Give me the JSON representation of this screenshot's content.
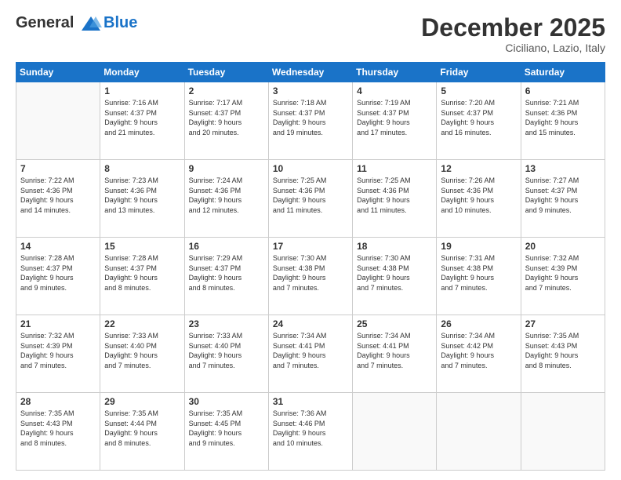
{
  "logo": {
    "line1": "General",
    "line2": "Blue"
  },
  "header": {
    "month_year": "December 2025",
    "location": "Ciciliano, Lazio, Italy"
  },
  "days_of_week": [
    "Sunday",
    "Monday",
    "Tuesday",
    "Wednesday",
    "Thursday",
    "Friday",
    "Saturday"
  ],
  "weeks": [
    [
      {
        "day": "",
        "info": ""
      },
      {
        "day": "1",
        "info": "Sunrise: 7:16 AM\nSunset: 4:37 PM\nDaylight: 9 hours\nand 21 minutes."
      },
      {
        "day": "2",
        "info": "Sunrise: 7:17 AM\nSunset: 4:37 PM\nDaylight: 9 hours\nand 20 minutes."
      },
      {
        "day": "3",
        "info": "Sunrise: 7:18 AM\nSunset: 4:37 PM\nDaylight: 9 hours\nand 19 minutes."
      },
      {
        "day": "4",
        "info": "Sunrise: 7:19 AM\nSunset: 4:37 PM\nDaylight: 9 hours\nand 17 minutes."
      },
      {
        "day": "5",
        "info": "Sunrise: 7:20 AM\nSunset: 4:37 PM\nDaylight: 9 hours\nand 16 minutes."
      },
      {
        "day": "6",
        "info": "Sunrise: 7:21 AM\nSunset: 4:36 PM\nDaylight: 9 hours\nand 15 minutes."
      }
    ],
    [
      {
        "day": "7",
        "info": "Sunrise: 7:22 AM\nSunset: 4:36 PM\nDaylight: 9 hours\nand 14 minutes."
      },
      {
        "day": "8",
        "info": "Sunrise: 7:23 AM\nSunset: 4:36 PM\nDaylight: 9 hours\nand 13 minutes."
      },
      {
        "day": "9",
        "info": "Sunrise: 7:24 AM\nSunset: 4:36 PM\nDaylight: 9 hours\nand 12 minutes."
      },
      {
        "day": "10",
        "info": "Sunrise: 7:25 AM\nSunset: 4:36 PM\nDaylight: 9 hours\nand 11 minutes."
      },
      {
        "day": "11",
        "info": "Sunrise: 7:25 AM\nSunset: 4:36 PM\nDaylight: 9 hours\nand 11 minutes."
      },
      {
        "day": "12",
        "info": "Sunrise: 7:26 AM\nSunset: 4:36 PM\nDaylight: 9 hours\nand 10 minutes."
      },
      {
        "day": "13",
        "info": "Sunrise: 7:27 AM\nSunset: 4:37 PM\nDaylight: 9 hours\nand 9 minutes."
      }
    ],
    [
      {
        "day": "14",
        "info": "Sunrise: 7:28 AM\nSunset: 4:37 PM\nDaylight: 9 hours\nand 9 minutes."
      },
      {
        "day": "15",
        "info": "Sunrise: 7:28 AM\nSunset: 4:37 PM\nDaylight: 9 hours\nand 8 minutes."
      },
      {
        "day": "16",
        "info": "Sunrise: 7:29 AM\nSunset: 4:37 PM\nDaylight: 9 hours\nand 8 minutes."
      },
      {
        "day": "17",
        "info": "Sunrise: 7:30 AM\nSunset: 4:38 PM\nDaylight: 9 hours\nand 7 minutes."
      },
      {
        "day": "18",
        "info": "Sunrise: 7:30 AM\nSunset: 4:38 PM\nDaylight: 9 hours\nand 7 minutes."
      },
      {
        "day": "19",
        "info": "Sunrise: 7:31 AM\nSunset: 4:38 PM\nDaylight: 9 hours\nand 7 minutes."
      },
      {
        "day": "20",
        "info": "Sunrise: 7:32 AM\nSunset: 4:39 PM\nDaylight: 9 hours\nand 7 minutes."
      }
    ],
    [
      {
        "day": "21",
        "info": "Sunrise: 7:32 AM\nSunset: 4:39 PM\nDaylight: 9 hours\nand 7 minutes."
      },
      {
        "day": "22",
        "info": "Sunrise: 7:33 AM\nSunset: 4:40 PM\nDaylight: 9 hours\nand 7 minutes."
      },
      {
        "day": "23",
        "info": "Sunrise: 7:33 AM\nSunset: 4:40 PM\nDaylight: 9 hours\nand 7 minutes."
      },
      {
        "day": "24",
        "info": "Sunrise: 7:34 AM\nSunset: 4:41 PM\nDaylight: 9 hours\nand 7 minutes."
      },
      {
        "day": "25",
        "info": "Sunrise: 7:34 AM\nSunset: 4:41 PM\nDaylight: 9 hours\nand 7 minutes."
      },
      {
        "day": "26",
        "info": "Sunrise: 7:34 AM\nSunset: 4:42 PM\nDaylight: 9 hours\nand 7 minutes."
      },
      {
        "day": "27",
        "info": "Sunrise: 7:35 AM\nSunset: 4:43 PM\nDaylight: 9 hours\nand 8 minutes."
      }
    ],
    [
      {
        "day": "28",
        "info": "Sunrise: 7:35 AM\nSunset: 4:43 PM\nDaylight: 9 hours\nand 8 minutes."
      },
      {
        "day": "29",
        "info": "Sunrise: 7:35 AM\nSunset: 4:44 PM\nDaylight: 9 hours\nand 8 minutes."
      },
      {
        "day": "30",
        "info": "Sunrise: 7:35 AM\nSunset: 4:45 PM\nDaylight: 9 hours\nand 9 minutes."
      },
      {
        "day": "31",
        "info": "Sunrise: 7:36 AM\nSunset: 4:46 PM\nDaylight: 9 hours\nand 10 minutes."
      },
      {
        "day": "",
        "info": ""
      },
      {
        "day": "",
        "info": ""
      },
      {
        "day": "",
        "info": ""
      }
    ]
  ]
}
